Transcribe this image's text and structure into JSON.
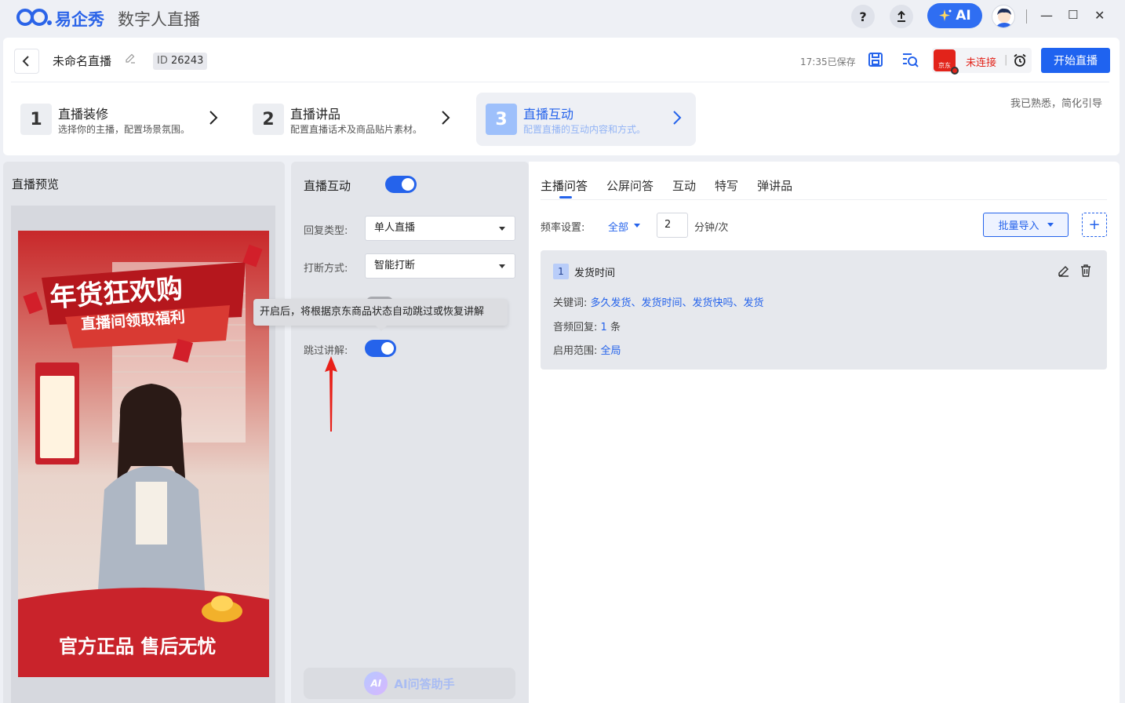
{
  "titlebar": {
    "logo_text": "易企秀",
    "app_title": "数字人直播",
    "help": "?",
    "ai_label": "AI",
    "minimize": "—",
    "maximize": "☐",
    "close": "✕"
  },
  "header": {
    "live_name": "未命名直播",
    "id_label": "ID",
    "id_value": "26243",
    "saved_text": "17:35已保存",
    "platform_logo": "京东",
    "connection_status": "未连接",
    "connection_sep": "|",
    "start_button": "开始直播",
    "guide_text": "我已熟悉，简化引导"
  },
  "steps": [
    {
      "num": "1",
      "title": "直播装修",
      "desc": "选择你的主播，配置场景氛围。"
    },
    {
      "num": "2",
      "title": "直播讲品",
      "desc": "配置直播话术及商品贴片素材。"
    },
    {
      "num": "3",
      "title": "直播互动",
      "desc": "配置直播的互动内容和方式。"
    }
  ],
  "preview": {
    "title": "直播预览",
    "banner_line1": "年货狂欢购",
    "banner_line2": "直播间领取福利",
    "bottom_text": "官方正品 售后无忧"
  },
  "settings": {
    "title": "直播互动",
    "reply_type_label": "回复类型:",
    "reply_type_value": "单人直播",
    "interrupt_label": "打断方式:",
    "interrupt_value": "智能打断",
    "skip_label": "跳过讲解:",
    "tooltip": "开启后，将根据京东商品状态自动跳过或恢复讲解",
    "ai_assistant": "AI问答助手",
    "ai_badge": "AI"
  },
  "tabs": [
    "主播问答",
    "公屏问答",
    "互动",
    "特写",
    "弹讲品"
  ],
  "frequency": {
    "label": "频率设置:",
    "scope": "全部",
    "value": "2",
    "unit": "分钟/次"
  },
  "batch_import": "批量导入",
  "add_label": "+",
  "qa_item": {
    "index": "1",
    "title": "发货时间",
    "keywords_label": "关键词:",
    "keywords": "多久发货、发货时间、发货快吗、发货",
    "audio_label": "音频回复:",
    "audio_count": "1",
    "audio_unit": "条",
    "scope_label": "启用范围:",
    "scope_value": "全局"
  },
  "colors": {
    "accent": "#2563eb",
    "danger": "#e2231a",
    "background": "#eef0f5"
  }
}
